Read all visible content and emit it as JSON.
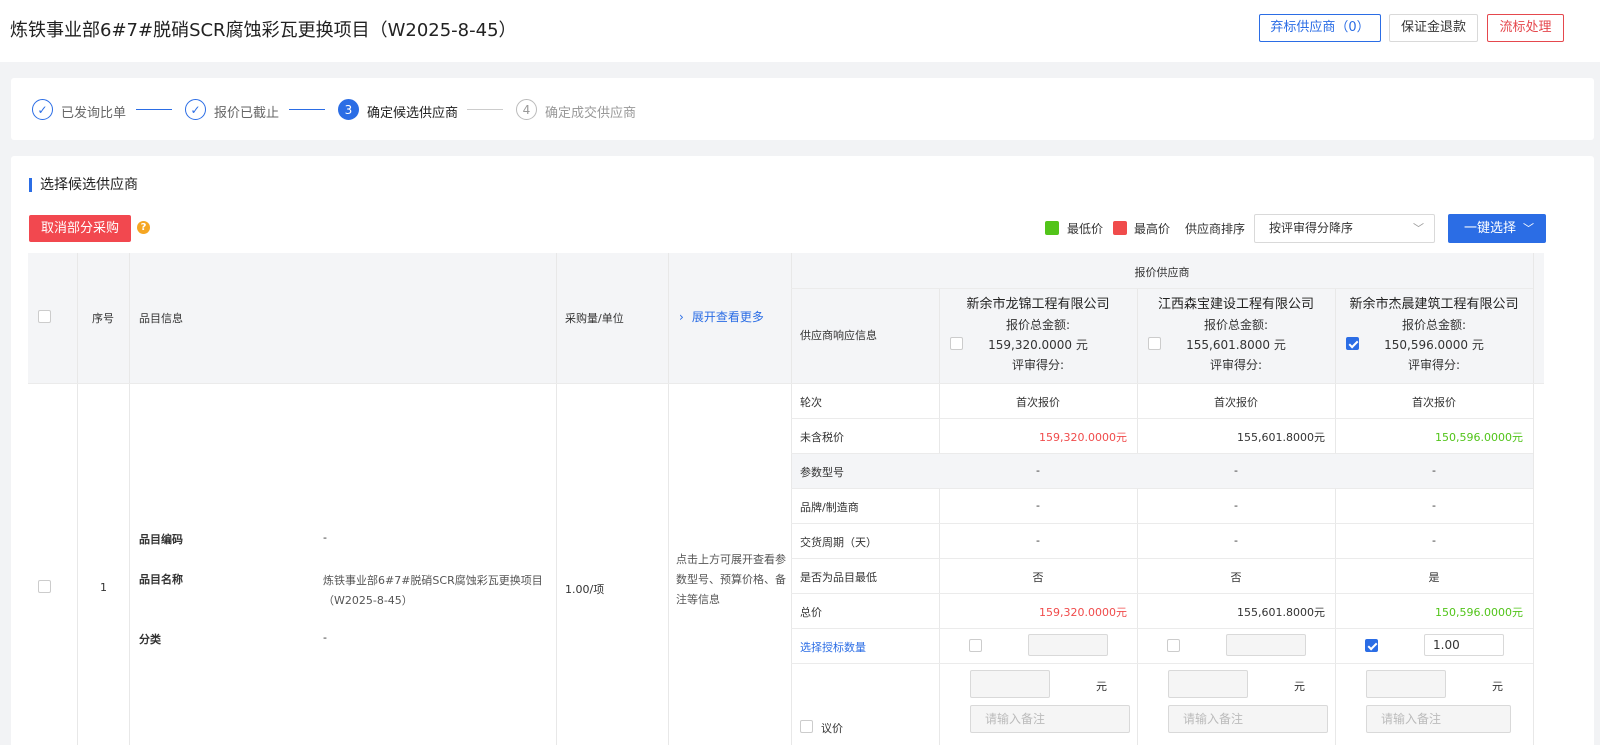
{
  "header": {
    "title": "炼铁事业部6#7#脱硝SCR腐蚀彩瓦更换项目（W2025-8-45）",
    "btn_abandon": "弃标供应商（0）",
    "btn_deposit": "保证金退款",
    "btn_fail": "流标处理"
  },
  "steps": [
    {
      "num": "1",
      "label": "已发询比单",
      "status": "done"
    },
    {
      "num": "2",
      "label": "报价已截止",
      "status": "done"
    },
    {
      "num": "3",
      "label": "确定候选供应商",
      "status": "active"
    },
    {
      "num": "4",
      "label": "确定成交供应商",
      "status": "todo"
    }
  ],
  "section": {
    "title": "选择候选供应商",
    "cancel_btn": "取消部分采购",
    "help": "?",
    "legend_low": "最低价",
    "legend_high": "最高价",
    "sort_label": "供应商排序",
    "sort_value": "按评审得分降序",
    "onekey_btn": "一键选择"
  },
  "colors": {
    "accent": "#2b6de5",
    "low": "#52c41a",
    "high": "#f04b4b"
  },
  "table": {
    "headers": {
      "seq": "序号",
      "item_info": "品目信息",
      "qty_unit": "采购量/单位",
      "expand": "展开查看更多",
      "quote_suppliers": "报价供应商",
      "resp_info": "供应商响应信息"
    },
    "suppliers": [
      {
        "name": "新余市龙锦工程有限公司",
        "total_label": "报价总金额:",
        "total": "159,320.0000 元",
        "score_label": "评审得分:",
        "checked": false,
        "round": "首次报价",
        "untaxed": "159,320.0000元",
        "param": "-",
        "brand": "-",
        "delivery": "-",
        "lowest": "否",
        "total_price": "159,320.0000元",
        "qty": "",
        "price_unit": "元",
        "remark_placeholder": "请输入备注",
        "color": "red"
      },
      {
        "name": "江西森宝建设工程有限公司",
        "total_label": "报价总金额:",
        "total": "155,601.8000 元",
        "score_label": "评审得分:",
        "checked": false,
        "round": "首次报价",
        "untaxed": "155,601.8000元",
        "param": "-",
        "brand": "-",
        "delivery": "-",
        "lowest": "否",
        "total_price": "155,601.8000元",
        "qty": "",
        "price_unit": "元",
        "remark_placeholder": "请输入备注",
        "color": "normal"
      },
      {
        "name": "新余市杰晨建筑工程有限公司",
        "total_label": "报价总金额:",
        "total": "150,596.0000 元",
        "score_label": "评审得分:",
        "checked": true,
        "round": "首次报价",
        "untaxed": "150,596.0000元",
        "param": "-",
        "brand": "-",
        "delivery": "-",
        "lowest": "是",
        "total_price": "150,596.0000元",
        "qty": "1.00",
        "price_unit": "元",
        "remark_placeholder": "请输入备注",
        "color": "green"
      }
    ],
    "row_labels": [
      "轮次",
      "未含税价",
      "参数型号",
      "品牌/制造商",
      "交货周期（天）",
      "是否为品目最低",
      "总价",
      "选择授标数量",
      "议价"
    ],
    "row": {
      "seq": "1",
      "code_label": "品目编码",
      "code_value": "-",
      "name_label": "品目名称",
      "name_value_1": "炼铁事业部6#7#脱硝SCR腐蚀彩瓦更换项目",
      "name_value_2": "（W2025-8-45）",
      "cat_label": "分类",
      "cat_value": "-",
      "qty": "1.00/项",
      "expand_hint_1": "点击上方可展开查看参",
      "expand_hint_2": "数型号、预算价格、备",
      "expand_hint_3": "注等信息"
    }
  }
}
